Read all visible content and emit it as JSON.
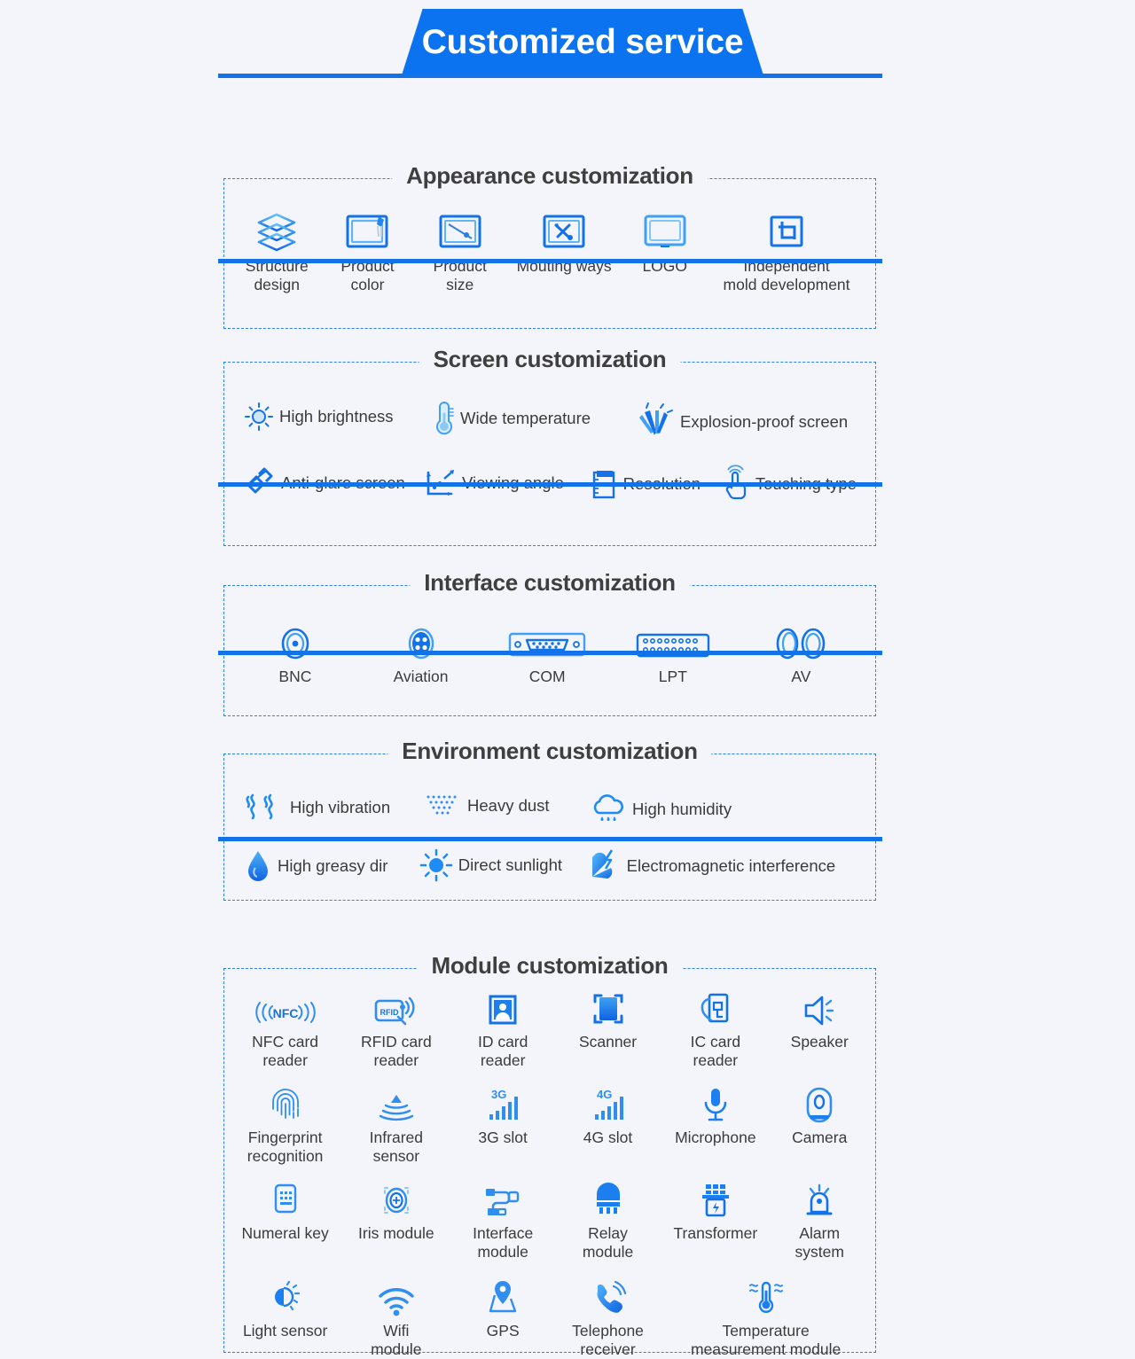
{
  "banner": {
    "title": "Customized service"
  },
  "sections": [
    {
      "id": "appearance",
      "title": "Appearance customization",
      "items": [
        {
          "label": "Structure\ndesign",
          "icon": "layers-icon"
        },
        {
          "label": "Product\ncolor",
          "icon": "paint-screen-icon"
        },
        {
          "label": "Product\nsize",
          "icon": "measure-screen-icon"
        },
        {
          "label": "Mouting ways",
          "icon": "tools-screen-icon"
        },
        {
          "label": "LOGO",
          "icon": "monitor-icon"
        },
        {
          "label": "Independent\nmold development",
          "icon": "crop-icon"
        }
      ]
    },
    {
      "id": "screen",
      "title": "Screen customization",
      "rows": [
        [
          {
            "label": "High brightness",
            "icon": "brightness-icon"
          },
          {
            "label": "Wide temperature",
            "icon": "thermometer-icon"
          },
          {
            "label": "Explosion-proof screen",
            "icon": "shatter-icon"
          }
        ],
        [
          {
            "label": "Anti-glare screen",
            "icon": "anti-glare-icon"
          },
          {
            "label": "Viewing angle",
            "icon": "viewing-angle-icon"
          },
          {
            "label": "Resolution",
            "icon": "resolution-icon"
          },
          {
            "label": "Touching type",
            "icon": "touch-icon"
          }
        ]
      ]
    },
    {
      "id": "interface",
      "title": "Interface customization",
      "items": [
        {
          "label": "BNC",
          "icon": "bnc-connector-icon"
        },
        {
          "label": "Aviation",
          "icon": "aviation-connector-icon"
        },
        {
          "label": "COM",
          "icon": "com-port-icon"
        },
        {
          "label": "LPT",
          "icon": "lpt-port-icon"
        },
        {
          "label": "AV",
          "icon": "av-connector-icon"
        }
      ]
    },
    {
      "id": "environment",
      "title": "Environment customization",
      "rows": [
        [
          {
            "label": "High vibration",
            "icon": "vibration-icon"
          },
          {
            "label": "Heavy dust",
            "icon": "dust-icon"
          },
          {
            "label": "High humidity",
            "icon": "humidity-cloud-icon"
          }
        ],
        [
          {
            "label": "High greasy dir",
            "icon": "oil-drop-icon"
          },
          {
            "label": "Direct sunlight",
            "icon": "sun-icon"
          },
          {
            "label": "Electromagnetic interference",
            "icon": "magnet-icon"
          }
        ]
      ]
    },
    {
      "id": "module",
      "title": "Module customization",
      "rows": [
        [
          {
            "label": "NFC card\nreader",
            "icon": "nfc-icon"
          },
          {
            "label": "RFID card\nreader",
            "icon": "rfid-icon"
          },
          {
            "label": "ID card\nreader",
            "icon": "id-card-icon"
          },
          {
            "label": "Scanner",
            "icon": "scanner-icon"
          },
          {
            "label": "IC card\nreader",
            "icon": "ic-card-icon"
          },
          {
            "label": "Speaker",
            "icon": "speaker-icon"
          }
        ],
        [
          {
            "label": "Fingerprint\nrecognition",
            "icon": "fingerprint-icon"
          },
          {
            "label": "Infrared\nsensor",
            "icon": "infrared-icon"
          },
          {
            "label": "3G slot",
            "icon": "signal-3g-icon"
          },
          {
            "label": "4G slot",
            "icon": "signal-4g-icon"
          },
          {
            "label": "Microphone",
            "icon": "microphone-icon"
          },
          {
            "label": "Camera",
            "icon": "camera-icon"
          }
        ],
        [
          {
            "label": "Numeral key",
            "icon": "keypad-icon"
          },
          {
            "label": "Iris module",
            "icon": "iris-icon"
          },
          {
            "label": "Interface\nmodule",
            "icon": "usb-interface-icon"
          },
          {
            "label": "Relay\nmodule",
            "icon": "relay-icon"
          },
          {
            "label": "Transformer",
            "icon": "transformer-icon"
          },
          {
            "label": "Alarm\nsystem",
            "icon": "alarm-icon"
          }
        ],
        [
          {
            "label": "Light sensor",
            "icon": "light-sensor-icon"
          },
          {
            "label": "Wifi\nmodule",
            "icon": "wifi-icon"
          },
          {
            "label": "GPS",
            "icon": "gps-pin-icon"
          },
          {
            "label": "Telephone\nreceiver",
            "icon": "telephone-icon"
          },
          {
            "label": "Temperature\nmeasurement module",
            "icon": "temp-measure-icon"
          }
        ]
      ]
    }
  ],
  "colors": {
    "accent": "#1372e8",
    "accent_light": "#3fa0f5",
    "background": "#f4f4fb",
    "text": "#3b3b3b",
    "banner": "#0b72f0"
  }
}
